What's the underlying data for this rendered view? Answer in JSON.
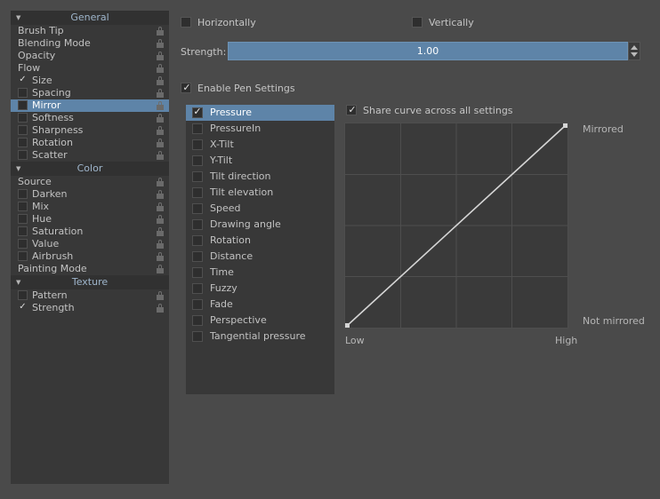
{
  "sidebar": {
    "sections": [
      {
        "name": "General",
        "label": "General",
        "collapse_icon": "triangle-down-icon",
        "items": [
          {
            "label": "Brush Tip",
            "checkbox": "none",
            "indent": false,
            "selected": false,
            "lock": true
          },
          {
            "label": "Blending Mode",
            "checkbox": "none",
            "indent": false,
            "selected": false,
            "lock": true
          },
          {
            "label": "Opacity",
            "checkbox": "none",
            "indent": false,
            "selected": false,
            "lock": true
          },
          {
            "label": "Flow",
            "checkbox": "none",
            "indent": false,
            "selected": false,
            "lock": true
          },
          {
            "label": "Size",
            "checkbox": "checked",
            "indent": true,
            "selected": false,
            "lock": true
          },
          {
            "label": "Spacing",
            "checkbox": "unchecked",
            "indent": true,
            "selected": false,
            "lock": true
          },
          {
            "label": "Mirror",
            "checkbox": "unchecked",
            "indent": true,
            "selected": true,
            "lock": true
          },
          {
            "label": "Softness",
            "checkbox": "unchecked",
            "indent": true,
            "selected": false,
            "lock": true
          },
          {
            "label": "Sharpness",
            "checkbox": "unchecked",
            "indent": true,
            "selected": false,
            "lock": true
          },
          {
            "label": "Rotation",
            "checkbox": "unchecked",
            "indent": true,
            "selected": false,
            "lock": true
          },
          {
            "label": "Scatter",
            "checkbox": "unchecked",
            "indent": true,
            "selected": false,
            "lock": true
          }
        ]
      },
      {
        "name": "Color",
        "label": "Color",
        "collapse_icon": "triangle-down-icon",
        "items": [
          {
            "label": "Source",
            "checkbox": "none",
            "indent": false,
            "selected": false,
            "lock": true
          },
          {
            "label": "Darken",
            "checkbox": "unchecked",
            "indent": true,
            "selected": false,
            "lock": true
          },
          {
            "label": "Mix",
            "checkbox": "unchecked",
            "indent": true,
            "selected": false,
            "lock": true
          },
          {
            "label": "Hue",
            "checkbox": "unchecked",
            "indent": true,
            "selected": false,
            "lock": true
          },
          {
            "label": "Saturation",
            "checkbox": "unchecked",
            "indent": true,
            "selected": false,
            "lock": true
          },
          {
            "label": "Value",
            "checkbox": "unchecked",
            "indent": true,
            "selected": false,
            "lock": true
          },
          {
            "label": "Airbrush",
            "checkbox": "unchecked",
            "indent": true,
            "selected": false,
            "lock": true
          },
          {
            "label": "Painting Mode",
            "checkbox": "none",
            "indent": false,
            "selected": false,
            "lock": true
          }
        ]
      },
      {
        "name": "Texture",
        "label": "Texture",
        "collapse_icon": "triangle-down-icon",
        "items": [
          {
            "label": "Pattern",
            "checkbox": "unchecked",
            "indent": true,
            "selected": false,
            "lock": true
          },
          {
            "label": "Strength",
            "checkbox": "checked",
            "indent": true,
            "selected": false,
            "lock": true
          }
        ]
      }
    ]
  },
  "mirror_options": {
    "horizontally": {
      "label": "Horizontally",
      "checked": false
    },
    "vertically": {
      "label": "Vertically",
      "checked": false
    }
  },
  "strength": {
    "label": "Strength:",
    "value": "1.00",
    "spin_up_icon": "triangle-up-icon",
    "spin_down_icon": "triangle-down-icon"
  },
  "pen_settings": {
    "enable": {
      "label": "Enable Pen Settings",
      "checked": true
    },
    "share_curve": {
      "label": "Share curve across all settings",
      "checked": true
    },
    "sensors": [
      {
        "label": "Pressure",
        "checked": true,
        "selected": true
      },
      {
        "label": "PressureIn",
        "checked": false,
        "selected": false
      },
      {
        "label": "X-Tilt",
        "checked": false,
        "selected": false
      },
      {
        "label": "Y-Tilt",
        "checked": false,
        "selected": false
      },
      {
        "label": "Tilt direction",
        "checked": false,
        "selected": false
      },
      {
        "label": "Tilt elevation",
        "checked": false,
        "selected": false
      },
      {
        "label": "Speed",
        "checked": false,
        "selected": false
      },
      {
        "label": "Drawing angle",
        "checked": false,
        "selected": false
      },
      {
        "label": "Rotation",
        "checked": false,
        "selected": false
      },
      {
        "label": "Distance",
        "checked": false,
        "selected": false
      },
      {
        "label": "Time",
        "checked": false,
        "selected": false
      },
      {
        "label": "Fuzzy",
        "checked": false,
        "selected": false
      },
      {
        "label": "Fade",
        "checked": false,
        "selected": false
      },
      {
        "label": "Perspective",
        "checked": false,
        "selected": false
      },
      {
        "label": "Tangential pressure",
        "checked": false,
        "selected": false
      }
    ]
  },
  "curve": {
    "x_axis_low": "Low",
    "x_axis_high": "High",
    "y_axis_top": "Mirrored",
    "y_axis_bottom": "Not mirrored",
    "grid_divisions": 4,
    "points": [
      {
        "x": 0.0,
        "y": 0.0
      },
      {
        "x": 1.0,
        "y": 1.0
      }
    ],
    "curve_color": "#d5d5d5"
  },
  "colors": {
    "window_bg": "#4a4a4a",
    "panel_bg": "#383838",
    "header_bg": "#313131",
    "selection": "#5e84a8",
    "text": "#c5c5c5",
    "header_text": "#9fb6cc",
    "curve_bg": "#3a3a3a"
  }
}
